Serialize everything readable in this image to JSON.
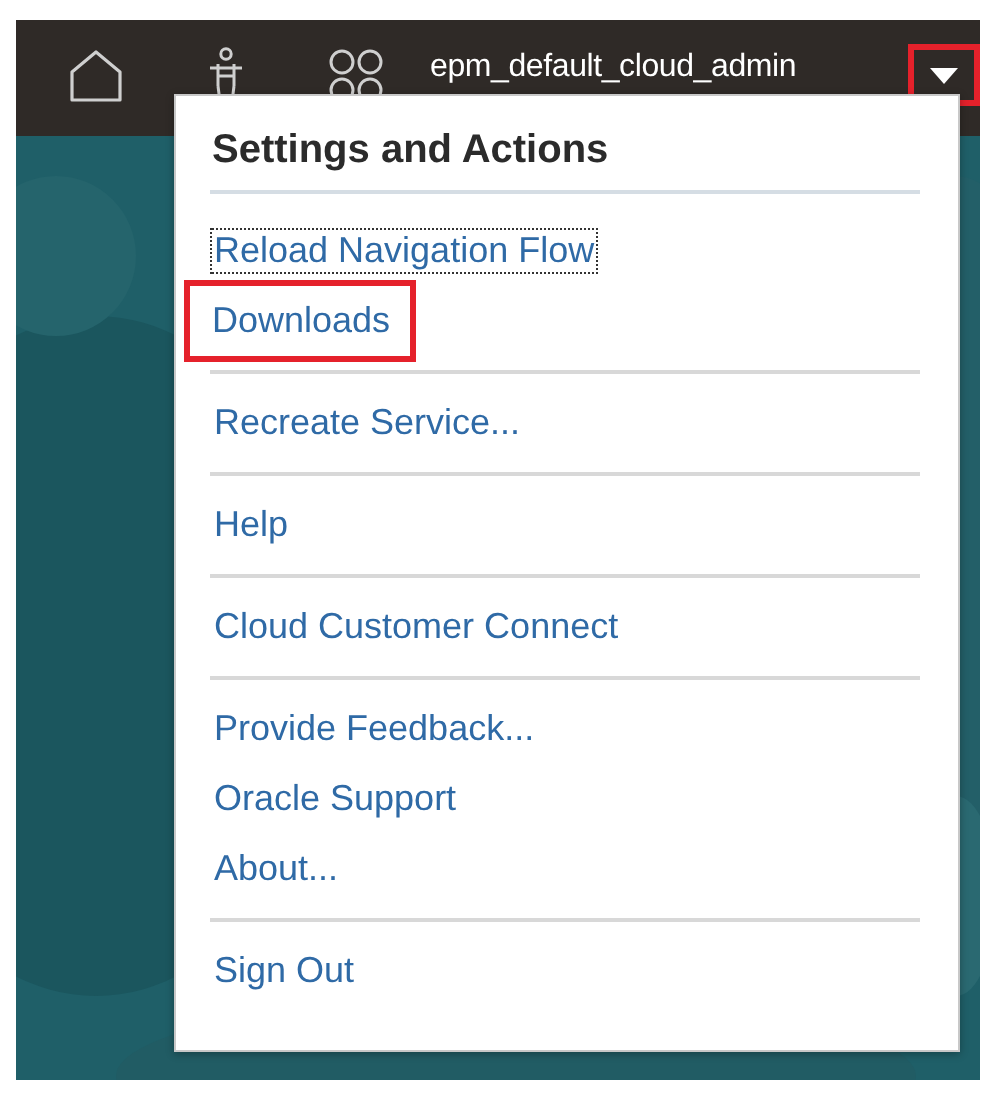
{
  "topbar": {
    "user": "epm_default_cloud_admin",
    "caret_highlighted": true
  },
  "menu": {
    "title": "Settings and Actions",
    "groups": [
      [
        {
          "label": "Reload Navigation Flow",
          "focused": true,
          "highlighted": false
        },
        {
          "label": "Downloads",
          "focused": false,
          "highlighted": true
        }
      ],
      [
        {
          "label": "Recreate Service...",
          "focused": false,
          "highlighted": false
        }
      ],
      [
        {
          "label": "Help",
          "focused": false,
          "highlighted": false
        }
      ],
      [
        {
          "label": "Cloud Customer Connect",
          "focused": false,
          "highlighted": false
        }
      ],
      [
        {
          "label": "Provide Feedback...",
          "focused": false,
          "highlighted": false
        },
        {
          "label": "Oracle Support",
          "focused": false,
          "highlighted": false
        },
        {
          "label": "About...",
          "focused": false,
          "highlighted": false
        }
      ],
      [
        {
          "label": "Sign Out",
          "focused": false,
          "highlighted": false
        }
      ]
    ]
  }
}
